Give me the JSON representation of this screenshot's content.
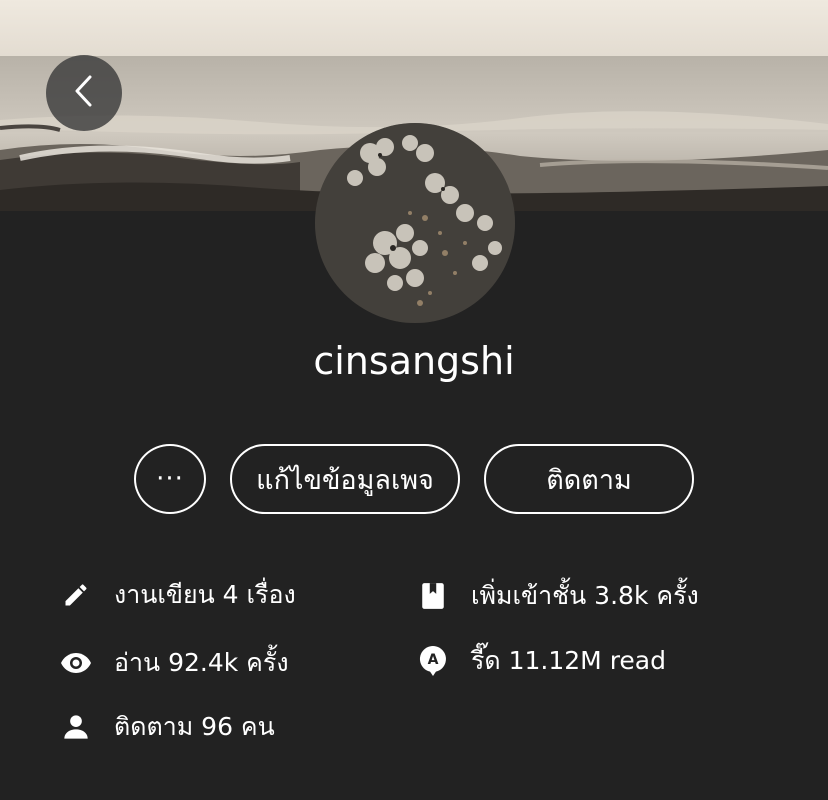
{
  "profile": {
    "username": "cinsangshi"
  },
  "actions": {
    "more_label": "···",
    "edit_label": "แก้ไขข้อมูลเพจ",
    "follow_label": "ติดตาม"
  },
  "stats": {
    "works": "งานเขียน 4 เรื่อง",
    "library_adds": "เพิ่มเข้าชั้น 3.8k ครั้ง",
    "reads": "อ่าน 92.4k ครั้ง",
    "reeds": "รี๊ด 11.12M read",
    "followers": "ติดตาม 96 คน"
  },
  "icons": {
    "back": "chevron-left-icon",
    "works": "pencil-icon",
    "library": "bookmark-book-icon",
    "reads": "eye-icon",
    "reeds": "reed-badge-icon",
    "followers": "person-icon"
  },
  "colors": {
    "background": "#222222",
    "text": "#ffffff",
    "cover_sky": "#ece6dc"
  }
}
